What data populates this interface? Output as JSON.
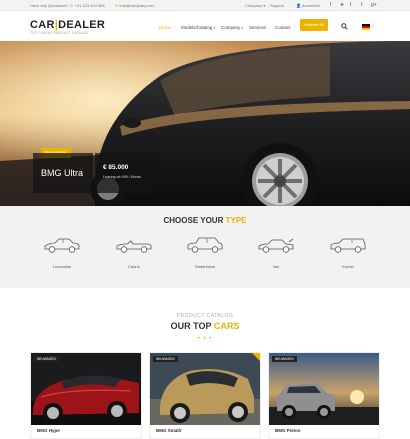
{
  "topbar": {
    "question": "Have any Questions?",
    "phone": "+01 123 444 555",
    "email": "info@company.com",
    "links": [
      "Company",
      "Support"
    ],
    "login": "Anmelden",
    "social_icons": [
      "facebook-icon",
      "send-icon",
      "twitter-icon",
      "tumblr-icon",
      "google-plus-icon"
    ]
  },
  "header": {
    "logo_left": "CAR",
    "logo_bar": "|",
    "logo_right": "DEALER",
    "tagline": "TOP CONTAO PRODUCT CATALOG",
    "nav": [
      "Home",
      "Models/Catalog",
      "Company",
      "Services",
      "Contact"
    ],
    "register": "Newslet fill"
  },
  "hero": {
    "tag": "Neuwagen",
    "title": "BMG Ultra",
    "price": "€ 85.000",
    "lease": "Leasing ab 499 / Monat",
    "slides": 3,
    "active_slide": 2
  },
  "types": {
    "heading": "CHOOSE YOUR",
    "heading_hl": "TYPE",
    "items": [
      "Limousine",
      "Cabrio",
      "Stufenheck",
      "Van",
      "Kombi"
    ]
  },
  "cars": {
    "subtitle": "PRODUCT CATALOG",
    "heading": "OUR TOP",
    "heading_hl": "CARS",
    "dots": "• • •",
    "items": [
      {
        "badge": "NEUWAGEN",
        "name": "BMG Hype"
      },
      {
        "badge": "NEUWAGEN",
        "name": "BMG Smallr"
      },
      {
        "badge": "NEUWAGEN",
        "name": "BMG Piston"
      }
    ]
  },
  "colors": {
    "accent": "#e8b400",
    "dark": "#222222",
    "type_section_bg": "#f2f2f2"
  }
}
